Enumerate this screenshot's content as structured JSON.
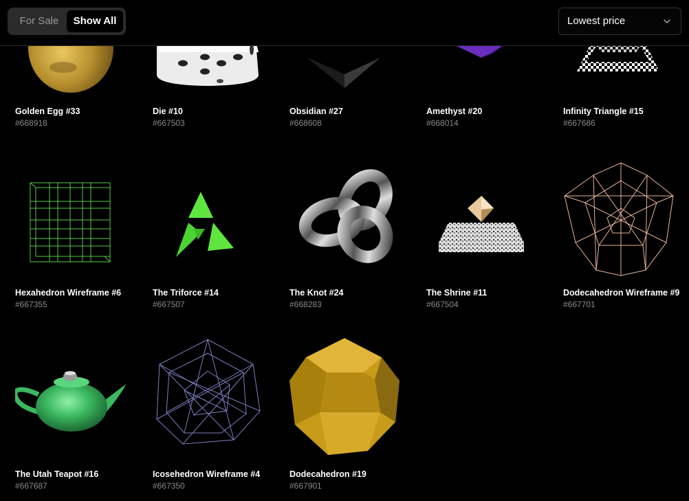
{
  "toolbar": {
    "filter_options": [
      "For Sale",
      "Show All"
    ],
    "active_filter": "Show All",
    "sort_label": "Lowest price"
  },
  "items": [
    {
      "title": "Golden Egg #33",
      "id": "#668918",
      "thumbnail": "golden-egg"
    },
    {
      "title": "Die #10",
      "id": "#667503",
      "thumbnail": "die"
    },
    {
      "title": "Obsidian #27",
      "id": "#668608",
      "thumbnail": "obsidian"
    },
    {
      "title": "Amethyst #20",
      "id": "#668014",
      "thumbnail": "amethyst"
    },
    {
      "title": "Infinity Triangle #15",
      "id": "#667686",
      "thumbnail": "infinity-triangle"
    },
    {
      "title": "Hexahedron Wireframe #6",
      "id": "#667355",
      "thumbnail": "hexahedron-wireframe"
    },
    {
      "title": "The Triforce #14",
      "id": "#667507",
      "thumbnail": "triforce"
    },
    {
      "title": "The Knot #24",
      "id": "#668283",
      "thumbnail": "knot"
    },
    {
      "title": "The Shrine #11",
      "id": "#667504",
      "thumbnail": "shrine"
    },
    {
      "title": "Dodecahedron Wireframe #9",
      "id": "#667701",
      "thumbnail": "dodecahedron-wireframe"
    },
    {
      "title": "The Utah Teapot #16",
      "id": "#667687",
      "thumbnail": "utah-teapot"
    },
    {
      "title": "Icosehedron Wireframe #4",
      "id": "#667350",
      "thumbnail": "icosahedron-wireframe"
    },
    {
      "title": "Dodecahedron #19",
      "id": "#667901",
      "thumbnail": "dodecahedron"
    }
  ]
}
